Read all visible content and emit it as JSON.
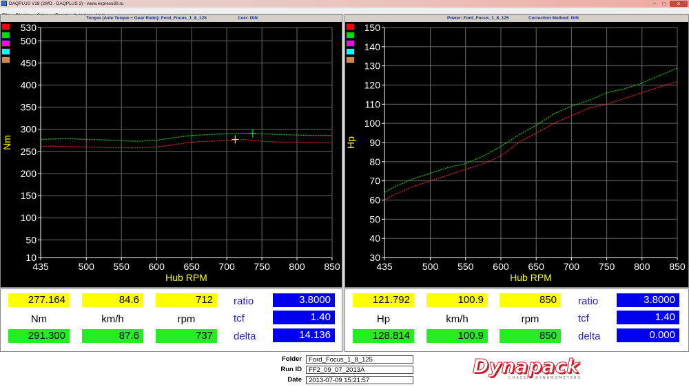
{
  "window": {
    "title": "DAQPLUS V18 (2WD - DAQPLUS 3) - www.express30.ru"
  },
  "menu": [
    "File",
    "Display",
    "Setup",
    "Reset",
    "Autoplot",
    "Help"
  ],
  "swatch_colors": [
    "#ff0000",
    "#00dd00",
    "#ff00ff",
    "#00ffff",
    "#d2884a"
  ],
  "line_colors": {
    "power_trace": "#ff2020",
    "corrected_trace": "#00e000"
  },
  "torque_panel": {
    "header_title": "Torque (Axle Torque ÷ Gear Ratio): Ford_Focus_1_8_125",
    "header_corr": "Corr: DIN",
    "readout": {
      "top": [
        "277.164",
        "84.6",
        "712"
      ],
      "units": [
        "Nm",
        "km/h",
        "rpm"
      ],
      "bottom": [
        "291.300",
        "87.6",
        "737"
      ],
      "ratio_label": "ratio",
      "ratio_value": "3.8000",
      "tcf_label": "tcf",
      "tcf_value": "1.40",
      "delta_label": "delta",
      "delta_value": "14.136"
    }
  },
  "power_panel": {
    "header_title": "Power: Ford_Focus_1_8_125",
    "header_corr": "Correction Method: DIN",
    "readout": {
      "top": [
        "121.792",
        "100.9",
        "850"
      ],
      "units": [
        "Hp",
        "km/h",
        "rpm"
      ],
      "bottom": [
        "128.814",
        "100.9",
        "850"
      ],
      "ratio_label": "ratio",
      "ratio_value": "3.8000",
      "tcf_label": "tcf",
      "tcf_value": "1.40",
      "delta_label": "delta",
      "delta_value": "0.000"
    }
  },
  "footer": {
    "folder_label": "Folder",
    "folder_value": "Ford_Focus_1_8_125",
    "runid_label": "Run ID",
    "runid_value": "FF2_09_07_2013A",
    "date_label": "Date",
    "date_value": "2013-07-09 15:21:57",
    "logo_text": "Dynapack",
    "logo_subtext": "CHASSIS DYNAMOMETERS"
  },
  "chart_data": [
    {
      "type": "line",
      "xlabel": "Hub RPM",
      "ylabel": "Nm",
      "xlim": [
        435,
        850
      ],
      "ylim": [
        10,
        530
      ],
      "x_ticks": [
        435,
        500,
        550,
        600,
        650,
        700,
        750,
        800,
        850
      ],
      "y_ticks": [
        10,
        50,
        100,
        150,
        200,
        250,
        300,
        350,
        400,
        450,
        500,
        530
      ],
      "grid": true,
      "cursors": [
        {
          "x": 712,
          "y": 277,
          "color": "#e8e0a0"
        },
        {
          "x": 737,
          "y": 291,
          "color": "#00e000"
        }
      ],
      "series": [
        {
          "color": "#ff2020",
          "x": [
            435,
            450,
            475,
            500,
            525,
            550,
            575,
            600,
            625,
            650,
            675,
            700,
            725,
            750,
            775,
            800,
            825,
            850
          ],
          "values": [
            261,
            262,
            261,
            260,
            259,
            258,
            258,
            260,
            265,
            271,
            273,
            275,
            277,
            273,
            271,
            271,
            270,
            269
          ]
        },
        {
          "color": "#00e000",
          "x": [
            435,
            450,
            475,
            500,
            525,
            550,
            575,
            600,
            625,
            650,
            675,
            700,
            725,
            750,
            775,
            800,
            825,
            850
          ],
          "values": [
            277,
            278,
            279,
            277,
            276,
            274,
            273,
            275,
            281,
            286,
            288,
            290,
            291,
            290,
            288,
            287,
            286,
            286
          ]
        }
      ]
    },
    {
      "type": "line",
      "xlabel": "Hub RPM",
      "ylabel": "Hp",
      "xlim": [
        435,
        850
      ],
      "ylim": [
        30,
        150
      ],
      "x_ticks": [
        435,
        500,
        550,
        600,
        650,
        700,
        750,
        800,
        850
      ],
      "y_ticks": [
        30,
        40,
        50,
        60,
        70,
        80,
        90,
        100,
        110,
        120,
        130,
        140,
        150
      ],
      "grid": true,
      "series": [
        {
          "color": "#ff2020",
          "x": [
            435,
            450,
            475,
            500,
            525,
            550,
            575,
            600,
            625,
            650,
            675,
            700,
            725,
            750,
            775,
            800,
            825,
            850
          ],
          "values": [
            60,
            63,
            67,
            70,
            73,
            76,
            79,
            83,
            90,
            95,
            100,
            104,
            108,
            110,
            113,
            116,
            119,
            121.8
          ]
        },
        {
          "color": "#00e000",
          "x": [
            435,
            450,
            475,
            500,
            525,
            550,
            575,
            600,
            625,
            650,
            675,
            700,
            725,
            750,
            775,
            800,
            825,
            850
          ],
          "values": [
            64,
            67,
            71,
            74,
            77,
            79,
            83,
            88,
            94,
            99,
            105,
            109,
            112,
            116,
            118,
            121,
            125,
            128.8
          ]
        }
      ]
    }
  ]
}
